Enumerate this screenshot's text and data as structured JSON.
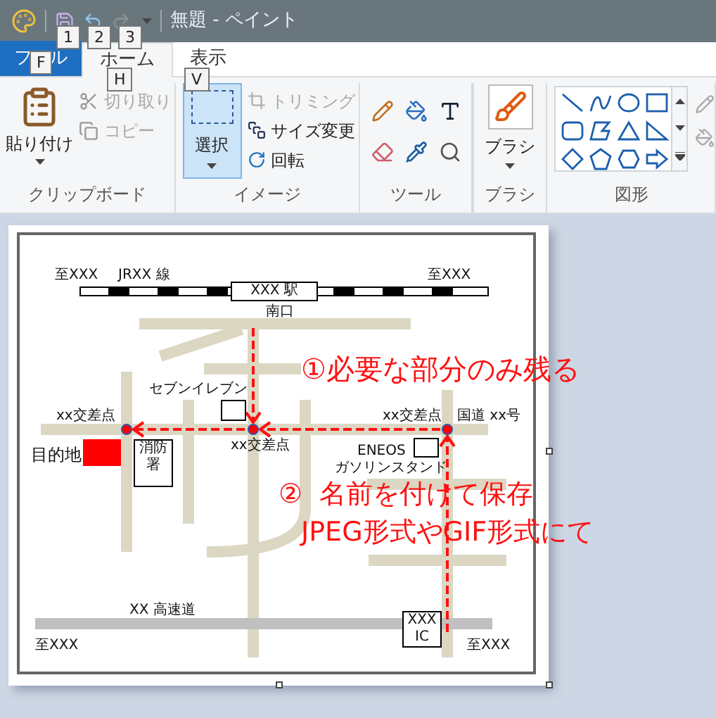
{
  "window": {
    "title": "無題 - ペイント",
    "quick_access_keytips": [
      "1",
      "2",
      "3"
    ]
  },
  "file_tab": {
    "label_parts": [
      "フ",
      "ル"
    ],
    "keytip": "F"
  },
  "tabs": [
    {
      "label": "ホーム",
      "keytip": "H",
      "selected": true
    },
    {
      "label": "表示",
      "keytip": "V",
      "selected": false
    }
  ],
  "clipboard": {
    "label": "クリップボード",
    "paste": "貼り付け",
    "cut": {
      "label": "切り取り",
      "disabled": true
    },
    "copy": {
      "label": "コピー",
      "disabled": true
    }
  },
  "image": {
    "label": "イメージ",
    "select": {
      "label": "選択",
      "selected": true
    },
    "crop": {
      "label": "トリミング",
      "disabled": true
    },
    "resize": {
      "label": "サイズ変更",
      "disabled": false
    },
    "rotate": {
      "label": "回転",
      "disabled": false
    }
  },
  "tools": {
    "label": "ツール"
  },
  "brushes": {
    "button_label": "ブラシ",
    "label": "ブラシ"
  },
  "shapes": {
    "label": "図形"
  },
  "map": {
    "labels": [
      "至XXX",
      "JRXX 線",
      "至XXX",
      "南口",
      "セブンイレブン",
      "xx交差点",
      "xx交差点",
      "xx交差点",
      "国道 xx号",
      "ENEOS",
      "ガソリンスタンド",
      "目的地",
      "XX 高速道",
      "至XXX",
      "至XXX"
    ],
    "boxes": [
      "XXX 駅",
      "消防署",
      "XXX IC"
    ]
  },
  "annotations": [
    "①必要な部分のみ残る",
    "②  名前を付けて保存",
    "JPEG形式やGIF形式にて"
  ]
}
